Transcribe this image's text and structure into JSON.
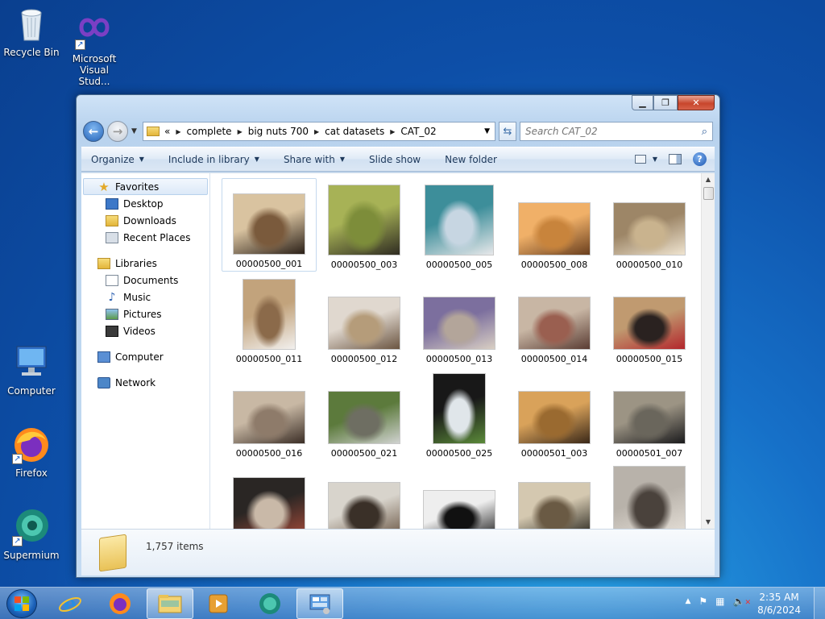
{
  "desktop": {
    "icons": [
      {
        "label": "Recycle Bin"
      },
      {
        "label": "Microsoft Visual Stud..."
      },
      {
        "label": "Computer"
      },
      {
        "label": "Firefox"
      },
      {
        "label": "Supermium"
      }
    ]
  },
  "window": {
    "controls": {
      "minimize": "▁",
      "maximize": "❐",
      "close": "✕"
    },
    "address": {
      "overflow": "«",
      "crumbs": [
        "complete",
        "big nuts 700",
        "cat datasets",
        "CAT_02"
      ]
    },
    "search_placeholder": "Search CAT_02",
    "toolbar": {
      "organize": "Organize",
      "include": "Include in library",
      "share": "Share with",
      "slideshow": "Slide show",
      "newfolder": "New folder"
    },
    "nav": {
      "favorites": "Favorites",
      "desktop": "Desktop",
      "downloads": "Downloads",
      "recent": "Recent Places",
      "libraries": "Libraries",
      "documents": "Documents",
      "music": "Music",
      "pictures": "Pictures",
      "videos": "Videos",
      "computer": "Computer",
      "network": "Network"
    },
    "files": [
      {
        "name": "00000500_001",
        "colors": [
          "#7a5a3c",
          "#d9c3a0",
          "#2b2018"
        ]
      },
      {
        "name": "00000500_003",
        "colors": [
          "#7d8d3a",
          "#a7b256",
          "#2f2c22"
        ]
      },
      {
        "name": "00000500_005",
        "colors": [
          "#c7d6e2",
          "#3d8e9a",
          "#e8e8ea"
        ]
      },
      {
        "name": "00000500_008",
        "colors": [
          "#c8843c",
          "#f0b068",
          "#6a3f1e"
        ]
      },
      {
        "name": "00000500_010",
        "colors": [
          "#c9b38e",
          "#9d8667",
          "#efe4d0"
        ]
      },
      {
        "name": "00000500_011",
        "colors": [
          "#8b6a4a",
          "#c2a37c",
          "#f2f0ee"
        ]
      },
      {
        "name": "00000500_012",
        "colors": [
          "#b59c7a",
          "#e0d8cf",
          "#6b5541"
        ]
      },
      {
        "name": "00000500_013",
        "colors": [
          "#b3a59a",
          "#7c6f9e",
          "#d9cfc3"
        ]
      },
      {
        "name": "00000500_014",
        "colors": [
          "#9a5f50",
          "#c8b6a4",
          "#5a3c33"
        ]
      },
      {
        "name": "00000500_015",
        "colors": [
          "#2a2220",
          "#c09a70",
          "#b3262c"
        ]
      },
      {
        "name": "00000500_016",
        "colors": [
          "#8e7b6a",
          "#c8b8a4",
          "#3b2e26"
        ]
      },
      {
        "name": "00000500_021",
        "colors": [
          "#6e6e62",
          "#5c7a3c",
          "#d0d2d0"
        ]
      },
      {
        "name": "00000500_025",
        "colors": [
          "#e0e6ea",
          "#181818",
          "#5b8a3a"
        ]
      },
      {
        "name": "00000501_003",
        "colors": [
          "#9a6a30",
          "#d9a25a",
          "#3a2818"
        ]
      },
      {
        "name": "00000501_007",
        "colors": [
          "#6a665c",
          "#9c9484",
          "#1a1a1c"
        ]
      },
      {
        "name": "",
        "colors": [
          "#c9b9a8",
          "#2a2624",
          "#a44b3a"
        ]
      },
      {
        "name": "",
        "colors": [
          "#3a3028",
          "#d8d4cc",
          "#6a5644"
        ]
      },
      {
        "name": "",
        "colors": [
          "#111111",
          "#eeeeee",
          "#222222"
        ]
      },
      {
        "name": "",
        "colors": [
          "#6a5a44",
          "#d4c8b0",
          "#222018"
        ]
      },
      {
        "name": "",
        "colors": [
          "#4a423c",
          "#b8b2aa",
          "#e8e2da"
        ]
      }
    ],
    "status": {
      "count": "1,757 items"
    }
  },
  "taskbar": {
    "clock_time": "2:35 AM",
    "clock_date": "8/6/2024"
  }
}
